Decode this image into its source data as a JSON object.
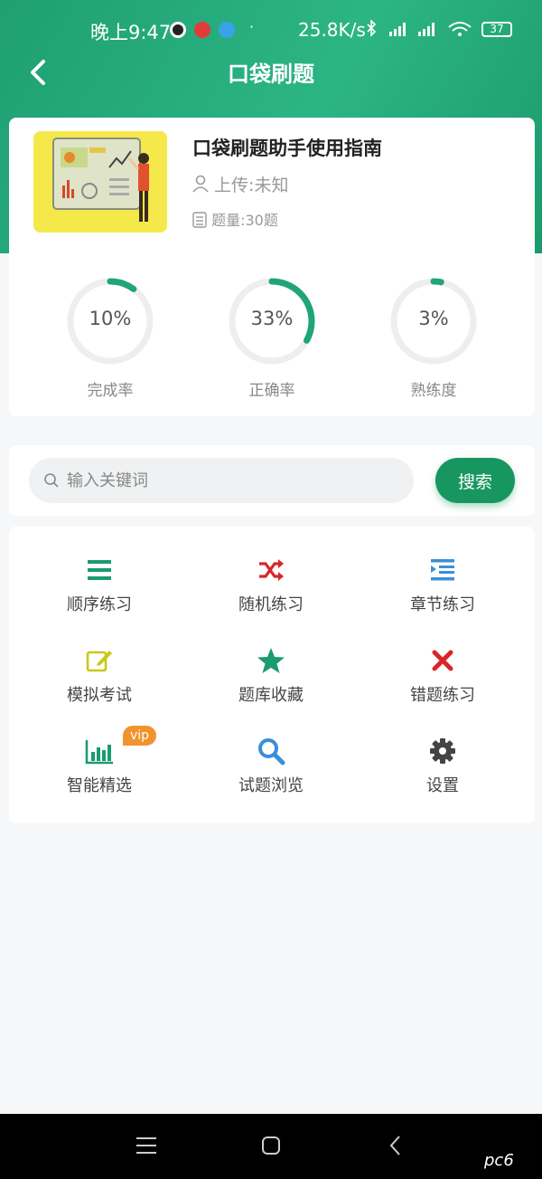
{
  "status_bar": {
    "time": "晚上9:47",
    "net_speed": "25.8K/s",
    "signal": "HD HD",
    "battery": "37"
  },
  "nav": {
    "title": "口袋刷题"
  },
  "book": {
    "title": "口袋刷题助手使用指南",
    "uploader": "上传:未知",
    "question_count": "题量:30题"
  },
  "stats": [
    {
      "value_text": "10%",
      "fraction": 0.1,
      "label": "完成率"
    },
    {
      "value_text": "33%",
      "fraction": 0.33,
      "label": "正确率"
    },
    {
      "value_text": "3%",
      "fraction": 0.03,
      "label": "熟练度"
    }
  ],
  "search": {
    "placeholder": "输入关键词",
    "value": "",
    "button_label": "搜索"
  },
  "menu": [
    {
      "label": "顺序练习",
      "icon": "list-icon",
      "color": "#1a9b70"
    },
    {
      "label": "随机练习",
      "icon": "shuffle-icon",
      "color": "#d9252a"
    },
    {
      "label": "章节练习",
      "icon": "chapter-indent-icon",
      "color": "#3a8fd8"
    },
    {
      "label": "模拟考试",
      "icon": "edit-icon",
      "color": "#c8c81a"
    },
    {
      "label": "题库收藏",
      "icon": "star-icon",
      "color": "#1a9b70"
    },
    {
      "label": "错题练习",
      "icon": "close-x-icon",
      "color": "#d9252a"
    },
    {
      "label": "智能精选",
      "icon": "bar-chart-icon",
      "color": "#1a9b70",
      "badge": "vip"
    },
    {
      "label": "试题浏览",
      "icon": "search-icon",
      "color": "#3a8fd8"
    },
    {
      "label": "设置",
      "icon": "gear-icon",
      "color": "#444444"
    }
  ],
  "colors": {
    "brand": "#1fa577",
    "accent_button": "#17975f",
    "vip": "#f1932e"
  },
  "watermark": "pc6"
}
